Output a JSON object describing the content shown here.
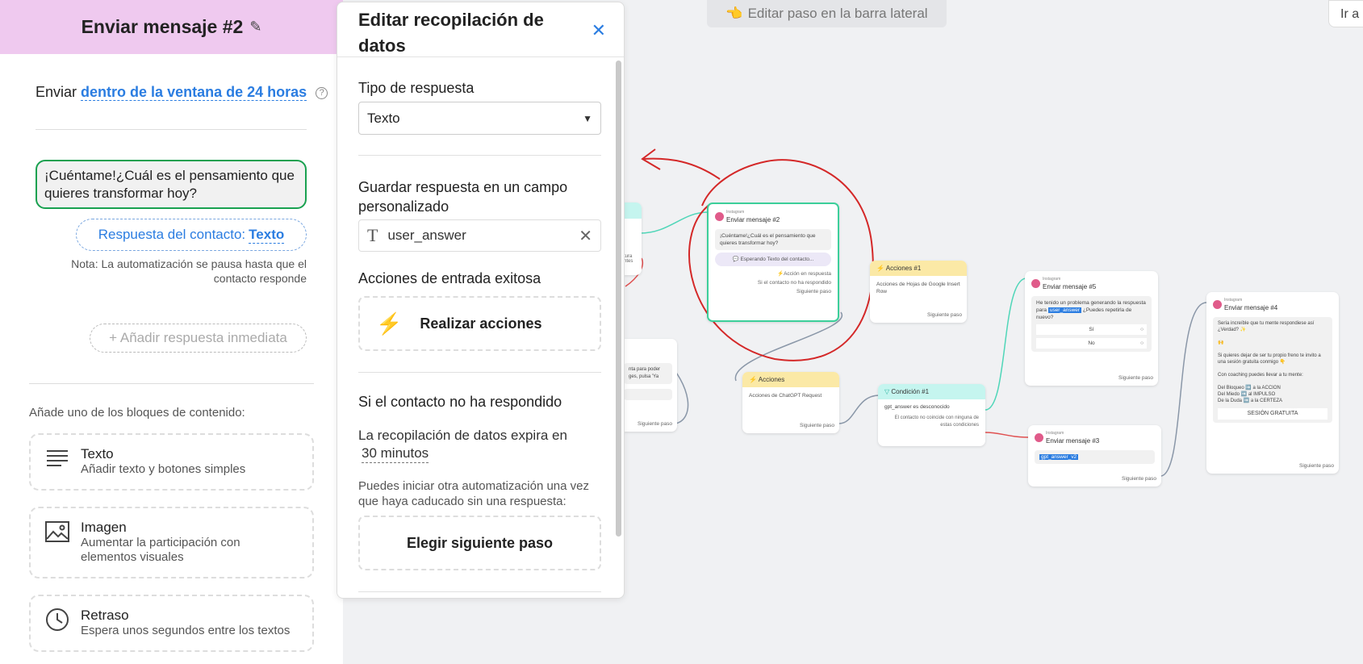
{
  "sidebar": {
    "title": "Enviar mensaje #2",
    "send_prefix": "Enviar",
    "send_link": "dentro de la ventana de 24 horas",
    "message": "¡Cuéntame!¿Cuál es el pensamiento que quieres transformar hoy?",
    "response_prefix": "Respuesta del contacto:",
    "response_type": "Texto",
    "note": "Nota: La automatización se pausa hasta que el contacto responde",
    "add_reply": "+ Añadir respuesta inmediata",
    "blocks_label": "Añade uno de los bloques de contenido:",
    "blocks": [
      {
        "title": "Texto",
        "desc": "Añadir texto y botones simples",
        "icon": "text-lines-icon"
      },
      {
        "title": "Imagen",
        "desc": "Aumentar la participación con elementos visuales",
        "icon": "image-icon"
      },
      {
        "title": "Retraso",
        "desc": "Espera unos segundos entre los textos",
        "icon": "clock-icon"
      }
    ]
  },
  "panel": {
    "title": "Editar recopilación de datos",
    "response_type_label": "Tipo de respuesta",
    "response_type_value": "Texto",
    "save_label": "Guardar respuesta en un campo personalizado",
    "field_value": "user_answer",
    "success_label": "Acciones de entrada exitosa",
    "actions_button": "Realizar acciones",
    "no_reply_label": "Si el contacto no ha respondido",
    "expires_prefix": "La recopilación de datos expira en",
    "expires_value": "30 minutos",
    "note": "Puedes iniciar otra automatización una vez que haya caducado sin una respuesta:",
    "next_step_button": "Elegir siguiente paso"
  },
  "canvas": {
    "top_hint": "Editar paso en la barra lateral",
    "top_right": "Ir a",
    "node_msg2": {
      "platform": "Instagram",
      "title": "Enviar mensaje #2",
      "text": "¡Cuéntame!¿Cuál es el pensamiento que quieres transformar hoy?",
      "waiting": "Esperando Texto del contacto...",
      "ok": "Acción en respuesta",
      "no_reply": "Si el contacto no ha respondido",
      "next": "Siguiente paso"
    },
    "node_acciones1": {
      "title": "Acciones #1",
      "text": "Acciones de Hojas de Google Insert Row",
      "next": "Siguiente paso"
    },
    "node_acciones": {
      "title": "Acciones",
      "text": "Acciones de ChatGPT Request",
      "next": "Siguiente paso"
    },
    "node_condicion": {
      "title": "Condición #1",
      "cond": "gpt_answer es desconocido",
      "else": "El contacto no coincide con ninguna de estas condiciones"
    },
    "node_msg5": {
      "platform": "Instagram",
      "title": "Enviar mensaje #5",
      "text_a": "He tenido un problema generando la respuesta para",
      "var": "user_answer",
      "text_b": "¿Puedes repetirla de nuevo?",
      "opt1": "Sí",
      "opt2": "No",
      "next": "Siguiente paso"
    },
    "node_msg3": {
      "platform": "Instagram",
      "title": "Enviar mensaje #3",
      "var": "gpt_answer_v2",
      "next": "Siguiente paso"
    },
    "node_msg4": {
      "platform": "Instagram",
      "title": "Enviar mensaje #4",
      "l1": "Sería increíble que tu mente respondiese así ¿Verdad? ✨",
      "l2": "🙌",
      "l3": "Si quieres dejar de ser tu propio freno te invito a una sesión gratuita conmigo 👇",
      "l4": "Con coaching puedes llevar a tu mente:",
      "l5": "Del Bloqueo ➡️ a la ACCION",
      "l6": "Del Miedo ➡️ al IMPULSO",
      "l7": "De la Duda ➡️ a la CERTEZA",
      "btn": "SESIÓN GRATUITA",
      "next": "Siguiente paso"
    },
    "partial_left": {
      "text": "nta para poder ges, pulsa 'Ya",
      "next": "Siguiente paso",
      "t1": "tura",
      "t2": "ntes"
    }
  }
}
